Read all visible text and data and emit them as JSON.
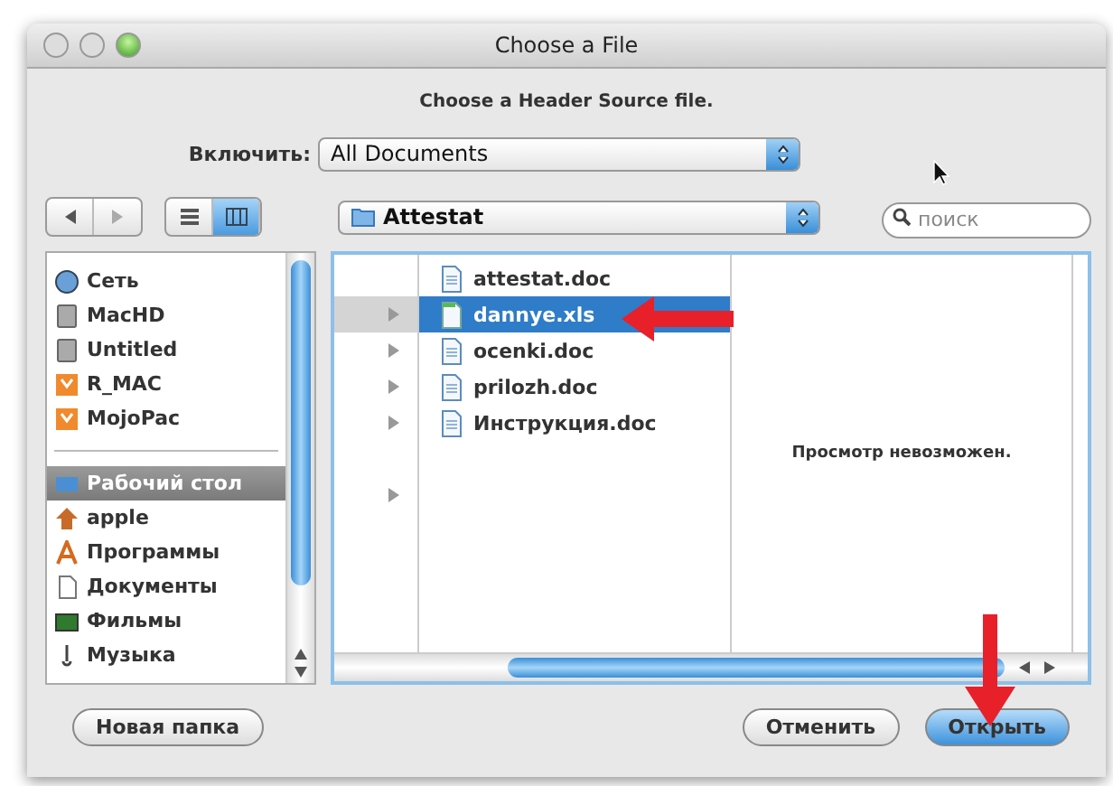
{
  "window": {
    "title": "Choose a File",
    "traffic_lights": [
      {
        "kind": "close"
      },
      {
        "kind": "minimize"
      },
      {
        "kind": "zoom"
      }
    ]
  },
  "message": "Choose a Header Source file.",
  "include": {
    "label": "Включить:",
    "value": "All Documents"
  },
  "toolbar": {
    "location": "Attestat",
    "search_placeholder": "поиск",
    "view_modes": [
      {
        "kind": "list",
        "selected": false
      },
      {
        "kind": "columns",
        "selected": true
      }
    ]
  },
  "sidebar": {
    "devices": [
      {
        "label": "Сеть",
        "kind": "network"
      },
      {
        "label": "MacHD",
        "kind": "disk"
      },
      {
        "label": "Untitled",
        "kind": "disk"
      },
      {
        "label": "R_MAC",
        "kind": "volume"
      },
      {
        "label": "MojoPac",
        "kind": "volume"
      }
    ],
    "places": [
      {
        "label": "Рабочий стол",
        "kind": "desktop",
        "selected": true
      },
      {
        "label": "apple",
        "kind": "home",
        "selected": false
      },
      {
        "label": "Программы",
        "kind": "apps",
        "selected": false
      },
      {
        "label": "Документы",
        "kind": "documents",
        "selected": false
      },
      {
        "label": "Фильмы",
        "kind": "movies",
        "selected": false
      },
      {
        "label": "Музыка",
        "kind": "music",
        "selected": false
      }
    ]
  },
  "parent_column": [
    {
      "kind": "blank"
    },
    {
      "kind": "folder",
      "selected": true
    },
    {
      "kind": "folder",
      "selected": false
    },
    {
      "kind": "folder",
      "selected": false
    },
    {
      "kind": "folder",
      "selected": false
    },
    {
      "kind": "blank"
    },
    {
      "kind": "folder",
      "selected": false
    }
  ],
  "files": [
    {
      "name": "attestat.doc",
      "kind": "doc",
      "selected": false
    },
    {
      "name": "dannye.xls",
      "kind": "xls",
      "selected": true
    },
    {
      "name": "ocenki.doc",
      "kind": "doc",
      "selected": false
    },
    {
      "name": "prilozh.doc",
      "kind": "doc",
      "selected": false
    },
    {
      "name": "Инструкция.doc",
      "kind": "doc",
      "selected": false
    }
  ],
  "preview": "Просмотр невозможен.",
  "buttons": [
    {
      "label": "Новая папка",
      "kind": "normal"
    },
    {
      "label": "Отменить",
      "kind": "normal"
    },
    {
      "label": "Открыть",
      "kind": "default"
    }
  ]
}
